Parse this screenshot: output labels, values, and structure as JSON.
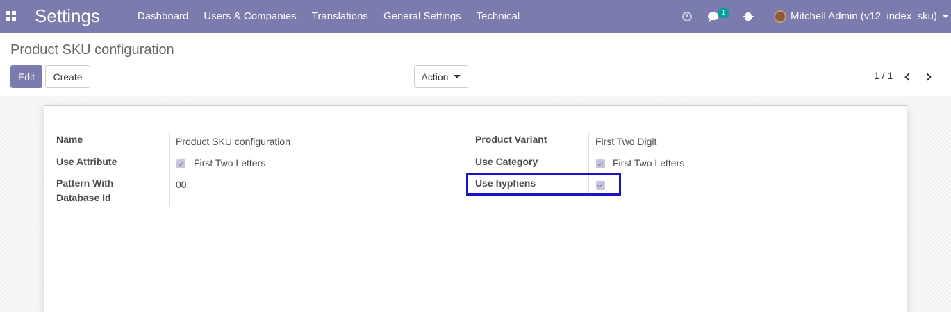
{
  "navbar": {
    "brand": "Settings",
    "menu": [
      "Dashboard",
      "Users & Companies",
      "Translations",
      "General Settings",
      "Technical"
    ],
    "messages_count": "1",
    "user_name": "Mitchell Admin (v12_index_sku)",
    "icons": [
      "apps-icon",
      "clock-icon",
      "chat-icon",
      "bug-icon"
    ],
    "bg_color": "#7c7bad"
  },
  "control": {
    "breadcrumb": "Product SKU configuration",
    "edit_label": "Edit",
    "create_label": "Create",
    "action_label": "Action",
    "pager": "1 / 1"
  },
  "form": {
    "left": {
      "name_label": "Name",
      "name_value": "Product SKU configuration",
      "use_attribute_label": "Use Attribute",
      "use_attribute_value": "First Two Letters",
      "use_attribute_checked": true,
      "pattern_label_1": "Pattern With",
      "pattern_label_2": "Database Id",
      "pattern_value": "00"
    },
    "right": {
      "product_variant_label": "Product Variant",
      "product_variant_value": "First Two Digit",
      "use_category_label": "Use Category",
      "use_category_value": "First Two Letters",
      "use_category_checked": true,
      "use_hyphens_label": "Use hyphens",
      "use_hyphens_checked": true
    }
  },
  "highlight_color": "#1a13c9"
}
